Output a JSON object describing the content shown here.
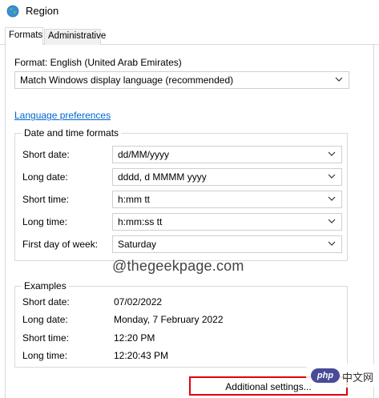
{
  "window": {
    "title": "Region"
  },
  "tabs": [
    {
      "label": "Formats",
      "active": true
    },
    {
      "label": "Administrative",
      "active": false
    }
  ],
  "format": {
    "label": "Format: English (United Arab Emirates)",
    "selected": "Match Windows display language (recommended)"
  },
  "language_link": "Language preferences",
  "date_time": {
    "legend": "Date and time formats",
    "rows": [
      {
        "label": "Short date:",
        "value": "dd/MM/yyyy"
      },
      {
        "label": "Long date:",
        "value": "dddd, d MMMM yyyy"
      },
      {
        "label": "Short time:",
        "value": "h:mm tt"
      },
      {
        "label": "Long time:",
        "value": "h:mm:ss tt"
      },
      {
        "label": "First day of week:",
        "value": "Saturday"
      }
    ]
  },
  "watermark": "@thegeekpage.com",
  "examples": {
    "legend": "Examples",
    "rows": [
      {
        "label": "Short date:",
        "value": "07/02/2022"
      },
      {
        "label": "Long date:",
        "value": "Monday, 7 February 2022"
      },
      {
        "label": "Short time:",
        "value": "12:20 PM"
      },
      {
        "label": "Long time:",
        "value": "12:20:43 PM"
      }
    ]
  },
  "additional_button": "Additional settings...",
  "php_logo": {
    "badge": "php",
    "text": "中文网"
  },
  "colors": {
    "link": "#0066cc",
    "highlight_border": "#e0000f",
    "php_badge": "#4a4a9a"
  },
  "icons": {
    "app": "globe-icon",
    "dropdown": "chevron-down-icon"
  }
}
